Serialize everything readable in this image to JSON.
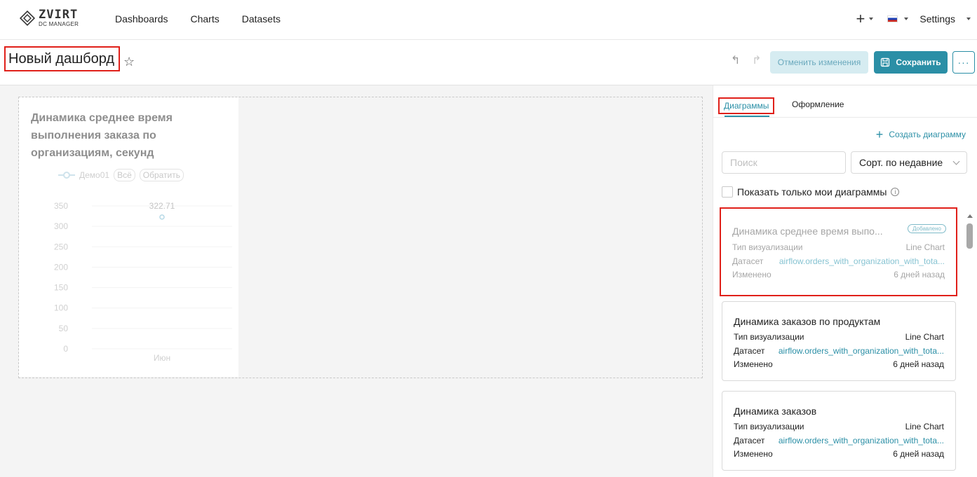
{
  "nav": {
    "logo_text": "ZVIRT",
    "logo_sub": "DC MANAGER",
    "items": [
      "Dashboards",
      "Charts",
      "Datasets"
    ],
    "settings": "Settings"
  },
  "header": {
    "title": "Новый дашборд",
    "cancel_label": "Отменить изменения",
    "save_label": "Сохранить",
    "more_label": "···"
  },
  "chart": {
    "title": "Динамика среднее время выполнения заказа по организациям, секунд",
    "legend": {
      "series": "Демо01",
      "all": "Всё",
      "invert": "Обратить"
    },
    "point_label": "322.71"
  },
  "chart_data": {
    "type": "line",
    "title": "Динамика среднее время выполнения заказа по организациям, секунд",
    "x": [
      "Июн"
    ],
    "series": [
      {
        "name": "Демо01",
        "values": [
          322.71
        ]
      }
    ],
    "yticks": [
      350,
      300,
      250,
      200,
      150,
      100,
      50,
      0
    ],
    "ylim": [
      0,
      350
    ],
    "legend": "top"
  },
  "panel": {
    "tabs": [
      "Диаграммы",
      "Оформление"
    ],
    "create_label": "Создать диаграмму",
    "search_placeholder": "Поиск",
    "sort_label": "Сорт. по недавние",
    "only_mine_label": "Показать только мои диаграммы",
    "cards": [
      {
        "title": "Динамика среднее время выпо...",
        "badge": "Добавлено",
        "type_label": "Тип визуализации",
        "type_value": "Line Chart",
        "dataset_label": "Датасет",
        "dataset_value": "airflow.orders_with_organization_with_tota...",
        "modified_label": "Изменено",
        "modified_value": "6 дней назад"
      },
      {
        "title": "Динамика заказов по продуктам",
        "type_label": "Тип визуализации",
        "type_value": "Line Chart",
        "dataset_label": "Датасет",
        "dataset_value": "airflow.orders_with_organization_with_tota...",
        "modified_label": "Изменено",
        "modified_value": "6 дней назад"
      },
      {
        "title": "Динамика заказов",
        "type_label": "Тип визуализации",
        "type_value": "Line Chart",
        "dataset_label": "Датасет",
        "dataset_value": "airflow.orders_with_organization_with_tota...",
        "modified_label": "Изменено",
        "modified_value": "6 дней назад"
      }
    ]
  },
  "colors": {
    "accent": "#2b8fa6",
    "highlight_border": "#e0201a",
    "canvas_bg": "#f4f4f4"
  }
}
